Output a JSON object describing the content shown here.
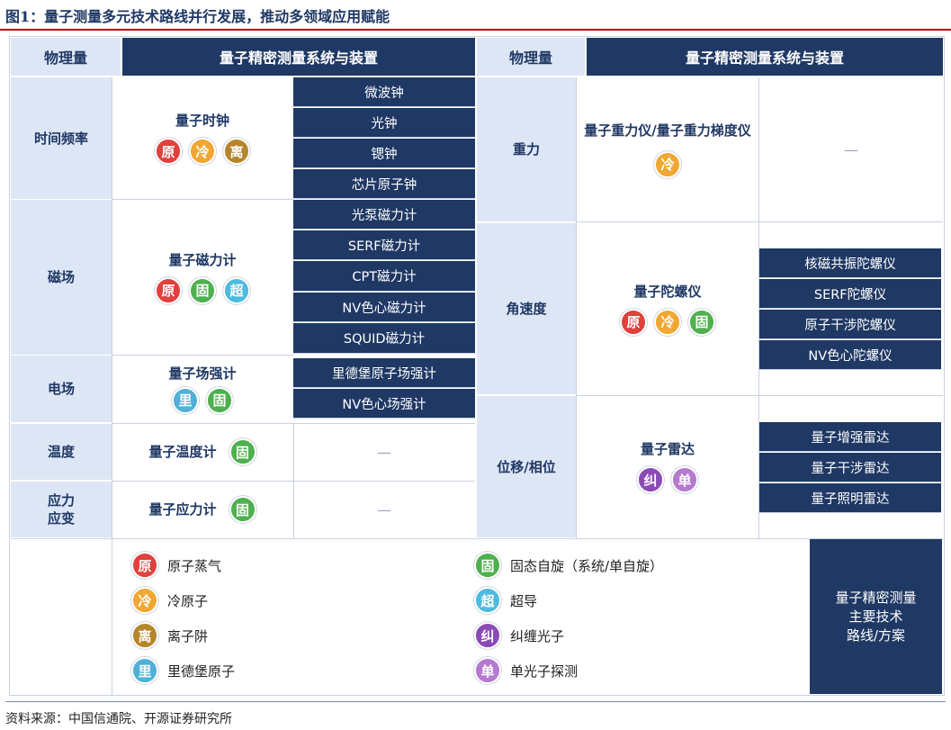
{
  "title": "图1：量子测量多元技术路线并行发展，推动多领域应用赋能",
  "headers": {
    "physical_quantity": "物理量",
    "system": "量子精密测量系统与装置"
  },
  "badges": {
    "yuan": {
      "char": "原",
      "color": "#e0413e"
    },
    "leng": {
      "char": "冷",
      "color": "#f0a733"
    },
    "li": {
      "char": "离",
      "color": "#b5862a"
    },
    "gu": {
      "char": "固",
      "color": "#4fb04f"
    },
    "chao": {
      "char": "超",
      "color": "#4dbbde"
    },
    "lid": {
      "char": "里",
      "color": "#4fb0d8"
    },
    "jiu": {
      "char": "纠",
      "color": "#8a4bb5"
    },
    "dan": {
      "char": "单",
      "color": "#b57ad0"
    }
  },
  "left_rows": [
    {
      "quantity": "时间频率",
      "device": "量子时钟",
      "badges": [
        "yuan",
        "leng",
        "li"
      ],
      "subs": [
        "微波钟",
        "光钟",
        "锶钟",
        "芯片原子钟"
      ]
    },
    {
      "quantity": "磁场",
      "device": "量子磁力计",
      "badges": [
        "yuan",
        "gu",
        "chao"
      ],
      "subs": [
        "光泵磁力计",
        "SERF磁力计",
        "CPT磁力计",
        "NV色心磁力计",
        "SQUID磁力计"
      ]
    },
    {
      "quantity": "电场",
      "device": "量子场强计",
      "badges": [
        "lid",
        "gu"
      ],
      "subs": [
        "里德堡原子场强计",
        "NV色心场强计"
      ]
    },
    {
      "quantity": "温度",
      "device": "量子温度计",
      "badges": [
        "gu"
      ],
      "subs": [],
      "dash": "—"
    },
    {
      "quantity": "应力\n应变",
      "device": "量子应力计",
      "badges": [
        "gu"
      ],
      "subs": [],
      "dash": "—"
    }
  ],
  "right_rows": [
    {
      "quantity": "重力",
      "device": "量子重力仪/量子重力梯度仪",
      "badges": [
        "leng"
      ],
      "subs": [],
      "dash": "—"
    },
    {
      "quantity": "角速度",
      "device": "量子陀螺仪",
      "badges": [
        "yuan",
        "leng",
        "gu"
      ],
      "subs": [
        "核磁共振陀螺仪",
        "SERF陀螺仪",
        "原子干涉陀螺仪",
        "NV色心陀螺仪"
      ]
    },
    {
      "quantity": "位移/相位",
      "device": "量子雷达",
      "badges": [
        "jiu",
        "dan"
      ],
      "subs": [
        "量子增强雷达",
        "量子干涉雷达",
        "量子照明雷达"
      ]
    }
  ],
  "legend": [
    {
      "badge": "yuan",
      "label": "原子蒸气"
    },
    {
      "badge": "leng",
      "label": "冷原子"
    },
    {
      "badge": "li",
      "label": "离子阱"
    },
    {
      "badge": "lid",
      "label": "里德堡原子"
    },
    {
      "badge": "gu",
      "label": "固态自旋（系统/单自旋）"
    },
    {
      "badge": "chao",
      "label": "超导"
    },
    {
      "badge": "jiu",
      "label": "纠缠光子"
    },
    {
      "badge": "dan",
      "label": "单光子探测"
    }
  ],
  "legend_box": "量子精密测量\n主要技术\n路线/方案",
  "source": "资料来源：中国信通院、开源证券研究所"
}
